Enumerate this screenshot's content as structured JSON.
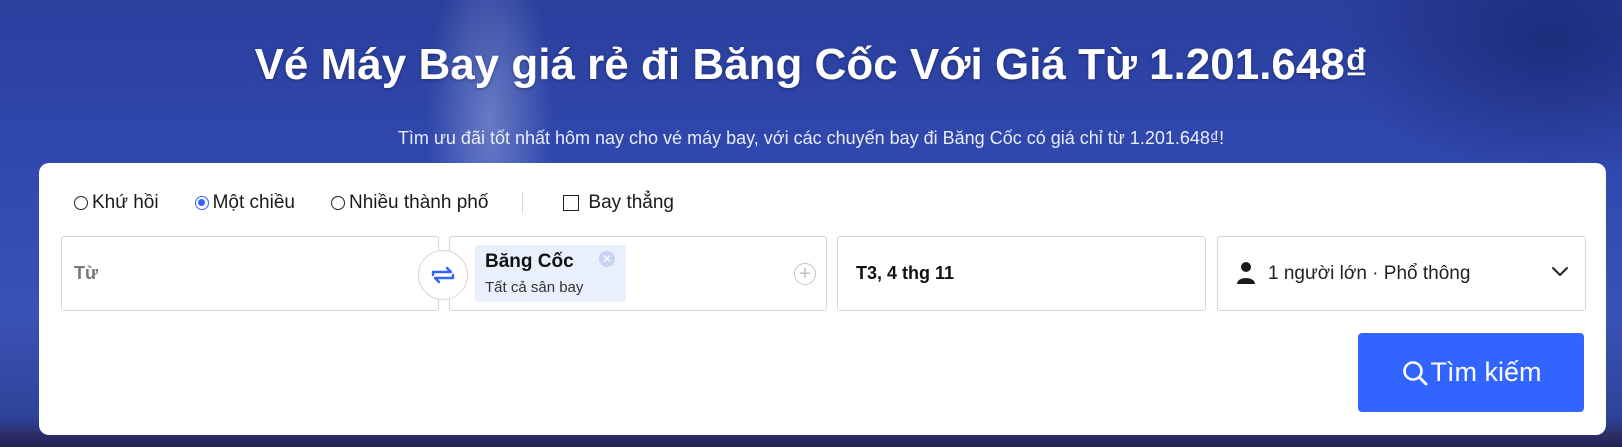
{
  "hero": {
    "title": "Vé Máy Bay giá rẻ đi Băng Cốc Với Giá Từ 1.201.648₫",
    "subtitle": "Tìm ưu đãi tốt nhất hôm nay cho vé máy bay, với các chuyến bay đi Băng Cốc có giá chỉ từ 1.201.648₫!"
  },
  "trip_types": [
    {
      "label": "Khứ hồi",
      "selected": false
    },
    {
      "label": "Một chiều",
      "selected": true
    },
    {
      "label": "Nhiều thành phố",
      "selected": false
    }
  ],
  "direct_flight": {
    "label": "Bay thẳng",
    "checked": false
  },
  "from": {
    "placeholder": "Từ",
    "icon": "swap-icon"
  },
  "to": {
    "city": "Băng Cốc",
    "airports": "Tất cả sân bay",
    "remove_icon": "close-icon",
    "add_icon": "plus-circle-icon"
  },
  "date": {
    "value": "T3, 4 thg 11"
  },
  "passengers": {
    "value": "1 người lớn · Phổ thông",
    "icon": "person-icon",
    "dropdown_icon": "chevron-down-icon"
  },
  "search": {
    "label": "Tìm kiếm",
    "icon": "search-icon"
  },
  "colors": {
    "accent": "#3264ff",
    "chip_bg": "#e9effd",
    "hero_bg": "#3149b0"
  }
}
